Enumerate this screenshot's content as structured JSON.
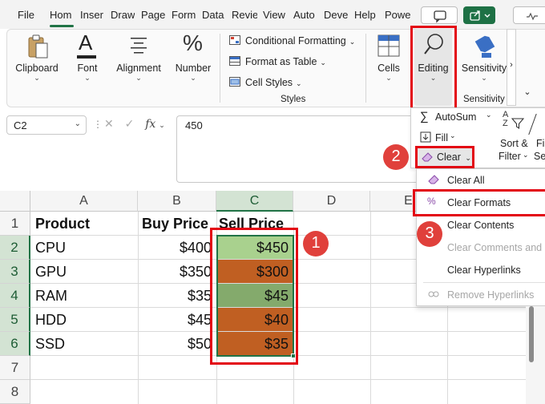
{
  "tabs": [
    "File",
    "Hom",
    "Inser",
    "Draw",
    "Page",
    "Form",
    "Data",
    "Revie",
    "View",
    "Auto",
    "Deve",
    "Help",
    "Powe"
  ],
  "ribbon": {
    "clipboard": "Clipboard",
    "font": "Font",
    "alignment": "Alignment",
    "number": "Number",
    "percent_glyph": "%",
    "font_glyph": "A",
    "styles": {
      "conditional_formatting": "Conditional Formatting",
      "format_as_table": "Format as Table",
      "cell_styles": "Cell Styles",
      "caption": "Styles"
    },
    "cells": "Cells",
    "editing": "Editing",
    "sensitivity": "Sensitivity",
    "sensitivity_caption": "Sensitivity"
  },
  "formula_bar": {
    "name_box": "C2",
    "formula": "450"
  },
  "columns": [
    "A",
    "B",
    "C",
    "D",
    "E"
  ],
  "rows": [
    "1",
    "2",
    "3",
    "4",
    "5",
    "6",
    "7",
    "8"
  ],
  "table": {
    "headers": [
      "Product",
      "Buy Price",
      "Sell Price"
    ],
    "data": [
      [
        "CPU",
        "$400",
        "$450"
      ],
      [
        "GPU",
        "$350",
        "$300"
      ],
      [
        "RAM",
        "$35",
        "$45"
      ],
      [
        "HDD",
        "$45",
        "$40"
      ],
      [
        "SSD",
        "$50",
        "$35"
      ]
    ],
    "fill_colors": [
      "#a9d18e",
      "#c05f22",
      "#84aa6c",
      "#c05f22",
      "#c05f22"
    ]
  },
  "editing_panel": {
    "autosum": "AutoSum",
    "fill": "Fill",
    "clear": "Clear",
    "sort_filter": "Sort &",
    "sort_filter_2": "Filter",
    "find_1": "Fi",
    "find_2": "Sel",
    "glyph_sigma": "∑",
    "glyph_az": "A\nZ"
  },
  "clear_menu": {
    "clear_all": "Clear All",
    "clear_formats": "Clear Formats",
    "clear_contents": "Clear Contents",
    "clear_comments": "Clear Comments and N",
    "clear_hyperlinks": "Clear Hyperlinks",
    "remove_hyperlinks": "Remove Hyperlinks"
  },
  "badges": [
    "1",
    "2",
    "3"
  ],
  "colors": {
    "accent": "#217346",
    "highlight": "#e30613",
    "badge": "#e0403b",
    "orange_fill": "#c05f22",
    "green_fill": "#a9d18e",
    "green_fill_dark": "#84aa6c"
  }
}
